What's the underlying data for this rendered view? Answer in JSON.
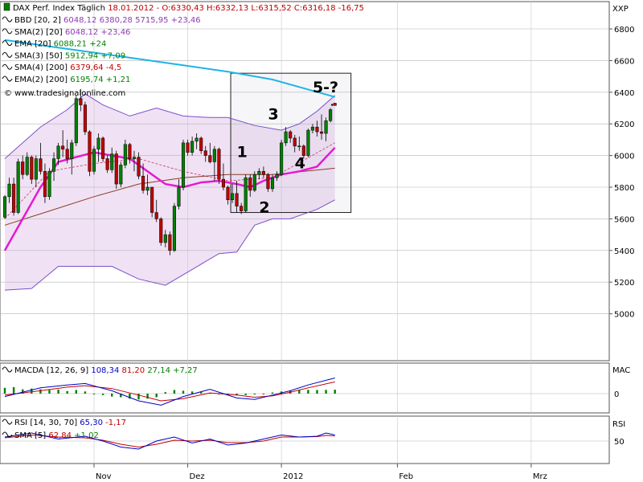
{
  "header": {
    "main_prefix": "DAX Perf. Index Täglich",
    "main_values": "18.01.2012 - O:6330,43 H:6332,13 L:6315,52 C:6316,18 -16,75",
    "legend": [
      {
        "name": "BBD [20, 2]",
        "values": "6048,12 6380,28 5715,95 +23,46",
        "color": "#8c3cb4"
      },
      {
        "name": "SMA(2) [20]",
        "values": "6048,12 +23,46",
        "color": "#8c3cb4"
      },
      {
        "name": "EMA [20]",
        "values": "6088,21 +24",
        "color": "#008000"
      },
      {
        "name": "SMA(3) [50]",
        "values": "5912,94 +7,09",
        "color": "#008000"
      },
      {
        "name": "SMA(4) [200]",
        "values": "6379,64 -4,5",
        "color": "#c80000"
      },
      {
        "name": "EMA(2) [200]",
        "values": "6195,74 +1,21",
        "color": "#008000"
      }
    ],
    "watermark": "© www.tradesignalonline.com"
  },
  "axes": {
    "main_unit": "XXP",
    "main_ticks": [
      "6800",
      "6600",
      "6400",
      "6200",
      "6000",
      "5800",
      "5600",
      "5400",
      "5200",
      "5000"
    ],
    "macd_unit": "MAC",
    "macd_ticks": [
      "0"
    ],
    "rsi_unit": "RSI",
    "rsi_ticks": [
      "50"
    ],
    "x_ticks": [
      "Nov",
      "Dez",
      "2012",
      "Feb",
      "Mrz"
    ]
  },
  "macd_legend": {
    "name": "MACDA [12, 26, 9]",
    "v1": "108,34",
    "v2": "81,20",
    "v3": "27,14",
    "v4": "+7,27"
  },
  "rsi_legend": {
    "name": "RSI [14, 30, 70]",
    "v1": "65,30",
    "v2": "-1,17"
  },
  "rsi_sma_legend": {
    "name": "SMA [5]",
    "v1": "62,84",
    "v2": "+1,02"
  },
  "annotations": [
    "1",
    "2",
    "3",
    "4",
    "5-?"
  ],
  "colors": {
    "up": "#008000",
    "down": "#c00000",
    "bb": "#7850c8",
    "ema_long": "#1eb4e6",
    "ema_mid": "#e619d2",
    "sma": "#8c3c28"
  },
  "chart_data": {
    "type": "candlestick",
    "instrument": "DAX Perf. Index",
    "ylim": [
      4900,
      6900
    ],
    "candles": [
      {
        "d": "2011-10-05",
        "o": 5610,
        "h": 5750,
        "l": 5600,
        "c": 5740
      },
      {
        "d": "2011-10-06",
        "o": 5740,
        "h": 5860,
        "l": 5700,
        "c": 5820
      },
      {
        "d": "2011-10-07",
        "o": 5820,
        "h": 5860,
        "l": 5620,
        "c": 5640
      },
      {
        "d": "2011-10-10",
        "o": 5640,
        "h": 5980,
        "l": 5630,
        "c": 5960
      },
      {
        "d": "2011-10-11",
        "o": 5960,
        "h": 6000,
        "l": 5850,
        "c": 5880
      },
      {
        "d": "2011-10-12",
        "o": 5880,
        "h": 6020,
        "l": 5870,
        "c": 5990
      },
      {
        "d": "2011-10-13",
        "o": 5990,
        "h": 6000,
        "l": 5820,
        "c": 5850
      },
      {
        "d": "2011-10-14",
        "o": 5850,
        "h": 6000,
        "l": 5800,
        "c": 5980
      },
      {
        "d": "2011-10-17",
        "o": 5980,
        "h": 6080,
        "l": 5880,
        "c": 5900
      },
      {
        "d": "2011-10-18",
        "o": 5900,
        "h": 5950,
        "l": 5700,
        "c": 5740
      },
      {
        "d": "2011-10-19",
        "o": 5740,
        "h": 5920,
        "l": 5720,
        "c": 5900
      },
      {
        "d": "2011-10-20",
        "o": 5900,
        "h": 6020,
        "l": 5840,
        "c": 5980
      },
      {
        "d": "2011-10-21",
        "o": 5980,
        "h": 6080,
        "l": 5940,
        "c": 6060
      },
      {
        "d": "2011-10-24",
        "o": 6060,
        "h": 6160,
        "l": 5990,
        "c": 6040
      },
      {
        "d": "2011-10-25",
        "o": 6040,
        "h": 6100,
        "l": 5950,
        "c": 5980
      },
      {
        "d": "2011-10-26",
        "o": 5980,
        "h": 6100,
        "l": 5880,
        "c": 6080
      },
      {
        "d": "2011-10-27",
        "o": 6080,
        "h": 6380,
        "l": 6060,
        "c": 6360
      },
      {
        "d": "2011-10-28",
        "o": 6360,
        "h": 6420,
        "l": 6280,
        "c": 6320
      },
      {
        "d": "2011-10-31",
        "o": 6320,
        "h": 6340,
        "l": 6130,
        "c": 6150
      },
      {
        "d": "2011-11-01",
        "o": 6150,
        "h": 6160,
        "l": 5870,
        "c": 5900
      },
      {
        "d": "2011-11-02",
        "o": 5900,
        "h": 6060,
        "l": 5880,
        "c": 6040
      },
      {
        "d": "2011-11-03",
        "o": 6040,
        "h": 6140,
        "l": 5960,
        "c": 6110
      },
      {
        "d": "2011-11-04",
        "o": 6110,
        "h": 6120,
        "l": 5960,
        "c": 5980
      },
      {
        "d": "2011-11-07",
        "o": 5980,
        "h": 6000,
        "l": 5890,
        "c": 5910
      },
      {
        "d": "2011-11-08",
        "o": 5910,
        "h": 6050,
        "l": 5890,
        "c": 6010
      },
      {
        "d": "2011-11-09",
        "o": 6010,
        "h": 6030,
        "l": 5790,
        "c": 5820
      },
      {
        "d": "2011-11-10",
        "o": 5820,
        "h": 5960,
        "l": 5800,
        "c": 5940
      },
      {
        "d": "2011-11-11",
        "o": 5940,
        "h": 6100,
        "l": 5920,
        "c": 6070
      },
      {
        "d": "2011-11-14",
        "o": 6070,
        "h": 6080,
        "l": 5950,
        "c": 5980
      },
      {
        "d": "2011-11-15",
        "o": 5980,
        "h": 6030,
        "l": 5900,
        "c": 5990
      },
      {
        "d": "2011-11-16",
        "o": 5990,
        "h": 6020,
        "l": 5850,
        "c": 5870
      },
      {
        "d": "2011-11-17",
        "o": 5870,
        "h": 5950,
        "l": 5760,
        "c": 5780
      },
      {
        "d": "2011-11-18",
        "o": 5780,
        "h": 5880,
        "l": 5750,
        "c": 5800
      },
      {
        "d": "2011-11-21",
        "o": 5800,
        "h": 5800,
        "l": 5610,
        "c": 5640
      },
      {
        "d": "2011-11-22",
        "o": 5640,
        "h": 5720,
        "l": 5580,
        "c": 5600
      },
      {
        "d": "2011-11-23",
        "o": 5600,
        "h": 5610,
        "l": 5430,
        "c": 5450
      },
      {
        "d": "2011-11-24",
        "o": 5450,
        "h": 5530,
        "l": 5420,
        "c": 5500
      },
      {
        "d": "2011-11-25",
        "o": 5500,
        "h": 5520,
        "l": 5370,
        "c": 5400
      },
      {
        "d": "2011-11-28",
        "o": 5400,
        "h": 5700,
        "l": 5390,
        "c": 5680
      },
      {
        "d": "2011-11-29",
        "o": 5680,
        "h": 5850,
        "l": 5660,
        "c": 5800
      },
      {
        "d": "2011-11-30",
        "o": 5800,
        "h": 6100,
        "l": 5780,
        "c": 6080
      },
      {
        "d": "2011-12-01",
        "o": 6080,
        "h": 6100,
        "l": 6000,
        "c": 6020
      },
      {
        "d": "2011-12-02",
        "o": 6020,
        "h": 6120,
        "l": 6000,
        "c": 6090
      },
      {
        "d": "2011-12-05",
        "o": 6090,
        "h": 6140,
        "l": 6040,
        "c": 6110
      },
      {
        "d": "2011-12-06",
        "o": 6110,
        "h": 6120,
        "l": 6010,
        "c": 6030
      },
      {
        "d": "2011-12-07",
        "o": 6030,
        "h": 6060,
        "l": 5960,
        "c": 6000
      },
      {
        "d": "2011-12-08",
        "o": 6000,
        "h": 6080,
        "l": 5950,
        "c": 5960
      },
      {
        "d": "2011-12-09",
        "o": 5960,
        "h": 6060,
        "l": 5840,
        "c": 6040
      },
      {
        "d": "2011-12-12",
        "o": 6040,
        "h": 6050,
        "l": 5820,
        "c": 5850
      },
      {
        "d": "2011-12-13",
        "o": 5850,
        "h": 5950,
        "l": 5780,
        "c": 5800
      },
      {
        "d": "2011-12-14",
        "o": 5800,
        "h": 5810,
        "l": 5690,
        "c": 5720
      },
      {
        "d": "2011-12-15",
        "o": 5720,
        "h": 5820,
        "l": 5700,
        "c": 5760
      },
      {
        "d": "2011-12-16",
        "o": 5760,
        "h": 5840,
        "l": 5640,
        "c": 5680
      },
      {
        "d": "2011-12-19",
        "o": 5680,
        "h": 5700,
        "l": 5630,
        "c": 5650
      },
      {
        "d": "2011-12-20",
        "o": 5650,
        "h": 5880,
        "l": 5640,
        "c": 5860
      },
      {
        "d": "2011-12-21",
        "o": 5860,
        "h": 5880,
        "l": 5740,
        "c": 5780
      },
      {
        "d": "2011-12-22",
        "o": 5780,
        "h": 5900,
        "l": 5770,
        "c": 5880
      },
      {
        "d": "2011-12-23",
        "o": 5880,
        "h": 5920,
        "l": 5850,
        "c": 5900
      },
      {
        "d": "2011-12-27",
        "o": 5900,
        "h": 5930,
        "l": 5860,
        "c": 5880
      },
      {
        "d": "2011-12-28",
        "o": 5880,
        "h": 5890,
        "l": 5770,
        "c": 5790
      },
      {
        "d": "2011-12-29",
        "o": 5790,
        "h": 5880,
        "l": 5770,
        "c": 5860
      },
      {
        "d": "2011-12-30",
        "o": 5860,
        "h": 5900,
        "l": 5840,
        "c": 5880
      },
      {
        "d": "2012-01-02",
        "o": 5880,
        "h": 6100,
        "l": 5870,
        "c": 6080
      },
      {
        "d": "2012-01-03",
        "o": 6080,
        "h": 6180,
        "l": 6060,
        "c": 6150
      },
      {
        "d": "2012-01-04",
        "o": 6150,
        "h": 6160,
        "l": 6080,
        "c": 6110
      },
      {
        "d": "2012-01-05",
        "o": 6110,
        "h": 6130,
        "l": 6020,
        "c": 6060
      },
      {
        "d": "2012-01-06",
        "o": 6060,
        "h": 6120,
        "l": 6030,
        "c": 6060
      },
      {
        "d": "2012-01-09",
        "o": 6060,
        "h": 6070,
        "l": 5980,
        "c": 6000
      },
      {
        "d": "2012-01-10",
        "o": 6000,
        "h": 6170,
        "l": 5990,
        "c": 6160
      },
      {
        "d": "2012-01-11",
        "o": 6160,
        "h": 6200,
        "l": 6140,
        "c": 6180
      },
      {
        "d": "2012-01-12",
        "o": 6180,
        "h": 6220,
        "l": 6120,
        "c": 6150
      },
      {
        "d": "2012-01-13",
        "o": 6150,
        "h": 6260,
        "l": 6100,
        "c": 6140
      },
      {
        "d": "2012-01-16",
        "o": 6140,
        "h": 6240,
        "l": 6090,
        "c": 6220
      },
      {
        "d": "2012-01-17",
        "o": 6220,
        "h": 6300,
        "l": 6210,
        "c": 6290
      },
      {
        "d": "2012-01-18",
        "o": 6330.43,
        "h": 6332.13,
        "l": 6315.52,
        "c": 6316.18
      }
    ],
    "ema200": [
      [
        0,
        6730
      ],
      [
        10,
        6690
      ],
      [
        20,
        6650
      ],
      [
        30,
        6610
      ],
      [
        40,
        6570
      ],
      [
        50,
        6530
      ],
      [
        60,
        6480
      ],
      [
        74,
        6370
      ]
    ],
    "ema20": [
      [
        0,
        5400
      ],
      [
        4,
        5600
      ],
      [
        8,
        5800
      ],
      [
        12,
        5960
      ],
      [
        16,
        5990
      ],
      [
        20,
        6020
      ],
      [
        24,
        6000
      ],
      [
        28,
        5980
      ],
      [
        32,
        5900
      ],
      [
        36,
        5820
      ],
      [
        40,
        5800
      ],
      [
        44,
        5830
      ],
      [
        48,
        5840
      ],
      [
        52,
        5820
      ],
      [
        55,
        5800
      ],
      [
        58,
        5840
      ],
      [
        62,
        5880
      ],
      [
        66,
        5900
      ],
      [
        70,
        5930
      ],
      [
        74,
        6050
      ]
    ],
    "sma200": [
      [
        0,
        5560
      ],
      [
        10,
        5650
      ],
      [
        20,
        5740
      ],
      [
        30,
        5820
      ],
      [
        40,
        5860
      ],
      [
        50,
        5880
      ],
      [
        60,
        5880
      ],
      [
        74,
        5920
      ]
    ],
    "sma20": [
      [
        0,
        5600
      ],
      [
        10,
        5900
      ],
      [
        20,
        5950
      ],
      [
        30,
        5980
      ],
      [
        40,
        5900
      ],
      [
        50,
        5840
      ],
      [
        60,
        5860
      ],
      [
        74,
        6080
      ]
    ],
    "bb_upper": [
      [
        0,
        5980
      ],
      [
        8,
        6180
      ],
      [
        14,
        6290
      ],
      [
        18,
        6390
      ],
      [
        22,
        6320
      ],
      [
        28,
        6250
      ],
      [
        34,
        6300
      ],
      [
        40,
        6250
      ],
      [
        46,
        6240
      ],
      [
        50,
        6240
      ],
      [
        56,
        6190
      ],
      [
        62,
        6160
      ],
      [
        66,
        6200
      ],
      [
        70,
        6280
      ],
      [
        74,
        6380
      ]
    ],
    "bb_lower": [
      [
        0,
        5150
      ],
      [
        6,
        5160
      ],
      [
        12,
        5300
      ],
      [
        18,
        5300
      ],
      [
        24,
        5300
      ],
      [
        30,
        5220
      ],
      [
        36,
        5180
      ],
      [
        42,
        5280
      ],
      [
        48,
        5380
      ],
      [
        52,
        5390
      ],
      [
        56,
        5560
      ],
      [
        60,
        5600
      ],
      [
        64,
        5600
      ],
      [
        70,
        5660
      ],
      [
        74,
        5720
      ]
    ],
    "macd": {
      "line": [
        [
          0,
          -20
        ],
        [
          8,
          40
        ],
        [
          14,
          60
        ],
        [
          18,
          70
        ],
        [
          24,
          20
        ],
        [
          30,
          -50
        ],
        [
          35,
          -80
        ],
        [
          40,
          -20
        ],
        [
          46,
          30
        ],
        [
          52,
          -30
        ],
        [
          56,
          -40
        ],
        [
          60,
          -10
        ],
        [
          64,
          20
        ],
        [
          68,
          60
        ],
        [
          74,
          108.34
        ]
      ],
      "signal": [
        [
          0,
          -10
        ],
        [
          8,
          20
        ],
        [
          14,
          45
        ],
        [
          18,
          55
        ],
        [
          24,
          35
        ],
        [
          30,
          -10
        ],
        [
          35,
          -50
        ],
        [
          40,
          -35
        ],
        [
          46,
          5
        ],
        [
          52,
          -10
        ],
        [
          56,
          -25
        ],
        [
          60,
          -15
        ],
        [
          64,
          10
        ],
        [
          68,
          40
        ],
        [
          74,
          81.2
        ]
      ],
      "hist": [
        [
          0,
          40
        ],
        [
          2,
          45
        ],
        [
          4,
          30
        ],
        [
          6,
          35
        ],
        [
          8,
          30
        ],
        [
          10,
          25
        ],
        [
          12,
          28
        ],
        [
          14,
          18
        ],
        [
          16,
          25
        ],
        [
          18,
          15
        ],
        [
          20,
          -5
        ],
        [
          22,
          -10
        ],
        [
          24,
          -20
        ],
        [
          26,
          -25
        ],
        [
          28,
          -35
        ],
        [
          30,
          -40
        ],
        [
          32,
          -35
        ],
        [
          34,
          -25
        ],
        [
          36,
          10
        ],
        [
          38,
          25
        ],
        [
          40,
          20
        ],
        [
          42,
          15
        ],
        [
          44,
          10
        ],
        [
          46,
          5
        ],
        [
          48,
          -5
        ],
        [
          50,
          -10
        ],
        [
          52,
          -12
        ],
        [
          54,
          -10
        ],
        [
          56,
          -6
        ],
        [
          58,
          0
        ],
        [
          60,
          8
        ],
        [
          62,
          15
        ],
        [
          64,
          22
        ],
        [
          66,
          25
        ],
        [
          68,
          26
        ],
        [
          70,
          25
        ],
        [
          72,
          26
        ],
        [
          74,
          27.14
        ]
      ]
    },
    "rsi": {
      "line": [
        [
          0,
          60
        ],
        [
          6,
          70
        ],
        [
          12,
          55
        ],
        [
          18,
          62
        ],
        [
          22,
          50
        ],
        [
          26,
          35
        ],
        [
          30,
          30
        ],
        [
          34,
          50
        ],
        [
          38,
          60
        ],
        [
          42,
          45
        ],
        [
          46,
          55
        ],
        [
          50,
          40
        ],
        [
          54,
          45
        ],
        [
          58,
          55
        ],
        [
          62,
          65
        ],
        [
          66,
          60
        ],
        [
          70,
          62
        ],
        [
          72,
          70
        ],
        [
          74,
          65.3
        ]
      ],
      "sma": [
        [
          0,
          58
        ],
        [
          6,
          65
        ],
        [
          12,
          60
        ],
        [
          18,
          58
        ],
        [
          22,
          52
        ],
        [
          26,
          42
        ],
        [
          30,
          35
        ],
        [
          34,
          42
        ],
        [
          38,
          52
        ],
        [
          42,
          50
        ],
        [
          46,
          52
        ],
        [
          50,
          46
        ],
        [
          54,
          46
        ],
        [
          58,
          50
        ],
        [
          62,
          60
        ],
        [
          66,
          60
        ],
        [
          70,
          61
        ],
        [
          72,
          64
        ],
        [
          74,
          62.84
        ]
      ]
    }
  }
}
